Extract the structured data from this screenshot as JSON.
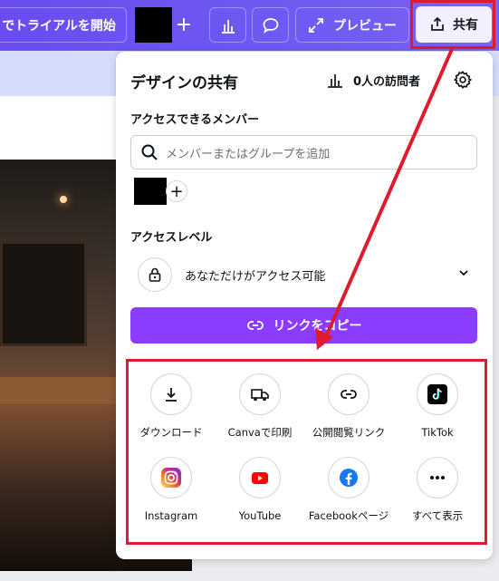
{
  "toolbar": {
    "trial_label": "でトライアルを開始",
    "plus": "+",
    "preview_label": "プレビュー",
    "share_label": "共有"
  },
  "panel": {
    "title": "デザインの共有",
    "visitors": "0人の訪問者",
    "members_heading": "アクセスできるメンバー",
    "search_placeholder": "メンバーまたはグループを追加",
    "add_member": "+",
    "access_heading": "アクセスレベル",
    "access_value": "あなただけがアクセス可能",
    "copy_link_label": "リンクをコピー",
    "options": [
      {
        "label": "ダウンロード",
        "icon": "download-icon"
      },
      {
        "label": "Canvaで印刷",
        "icon": "truck-icon"
      },
      {
        "label": "公開閲覧リンク",
        "icon": "link-icon"
      },
      {
        "label": "TikTok",
        "icon": "tiktok-icon"
      },
      {
        "label": "Instagram",
        "icon": "instagram-icon"
      },
      {
        "label": "YouTube",
        "icon": "youtube-icon"
      },
      {
        "label": "Facebookページ",
        "icon": "facebook-icon"
      },
      {
        "label": "すべて表示",
        "icon": "more-icon"
      }
    ]
  },
  "colors": {
    "accent": "#8b3dff",
    "annotation_red": "#e01b2e",
    "toolbar": "#6e5af2"
  }
}
